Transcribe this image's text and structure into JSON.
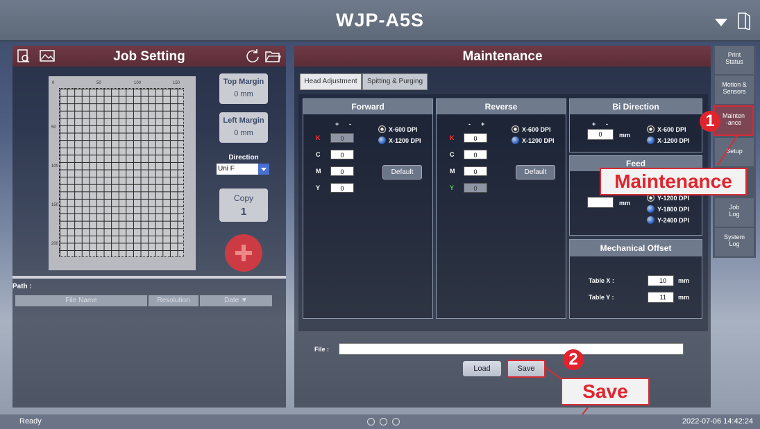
{
  "app": {
    "title": "WJP-A5S"
  },
  "job": {
    "title": "Job Setting",
    "top_margin_label": "Top Margin",
    "top_margin_value": "0 mm",
    "left_margin_label": "Left Margin",
    "left_margin_value": "0 mm",
    "direction_label": "Direction",
    "direction_value": "Uni F",
    "copy_label": "Copy",
    "copy_value": "1",
    "ruler_x": [
      "0",
      "50",
      "100",
      "150"
    ],
    "ruler_y": [
      "50",
      "100",
      "150",
      "200"
    ],
    "path_label": "Path :",
    "columns": [
      "File Name",
      "Resolution",
      "Date ▼"
    ]
  },
  "maint": {
    "title": "Maintenance",
    "tabs": [
      "Head Adjustment",
      "Spitting & Purging"
    ],
    "forward": {
      "title": "Forward",
      "plus": "+",
      "minus": "-",
      "rows": [
        {
          "label": "K",
          "value": "0"
        },
        {
          "label": "C",
          "value": "0"
        },
        {
          "label": "M",
          "value": "0"
        },
        {
          "label": "Y",
          "value": "0"
        }
      ],
      "opt1": "X-600 DPI",
      "opt2": "X-1200 DPI",
      "default": "Default"
    },
    "reverse": {
      "title": "Reverse",
      "minus": "-",
      "plus": "+",
      "rows": [
        {
          "label": "K",
          "value": "0"
        },
        {
          "label": "C",
          "value": "0"
        },
        {
          "label": "M",
          "value": "0"
        },
        {
          "label": "Y",
          "value": "0"
        }
      ],
      "opt1": "X-600 DPI",
      "opt2": "X-1200 DPI",
      "default": "Default"
    },
    "bidir": {
      "title": "Bi Direction",
      "plus": "+",
      "minus": "-",
      "value": "0",
      "unit": "mm",
      "opt1": "X-600 DPI",
      "opt2": "X-1200 DPI"
    },
    "feed": {
      "title": "Feed",
      "unit": "mm",
      "opt1": "Y-1200 DPI",
      "opt2": "Y-1800 DPI",
      "opt3": "Y-2400 DPI"
    },
    "mech": {
      "title": "Mechanical Offset",
      "tx_label": "Table X :",
      "tx_value": "10",
      "ty_label": "Table Y :",
      "ty_value": "11",
      "unit": "mm"
    },
    "file_label": "File :",
    "load": "Load",
    "save": "Save"
  },
  "side": {
    "items": [
      "Print\nStatus",
      "Motion &\nSensors",
      "Mainten\n-ance",
      "Setup",
      "Job\nLog",
      "System\nLog"
    ]
  },
  "callouts": {
    "one": "1",
    "one_text": "Maintenance",
    "two": "2",
    "two_text": "Save"
  },
  "status": {
    "left": "Ready",
    "right": "2022-07-06 14:42:24"
  }
}
